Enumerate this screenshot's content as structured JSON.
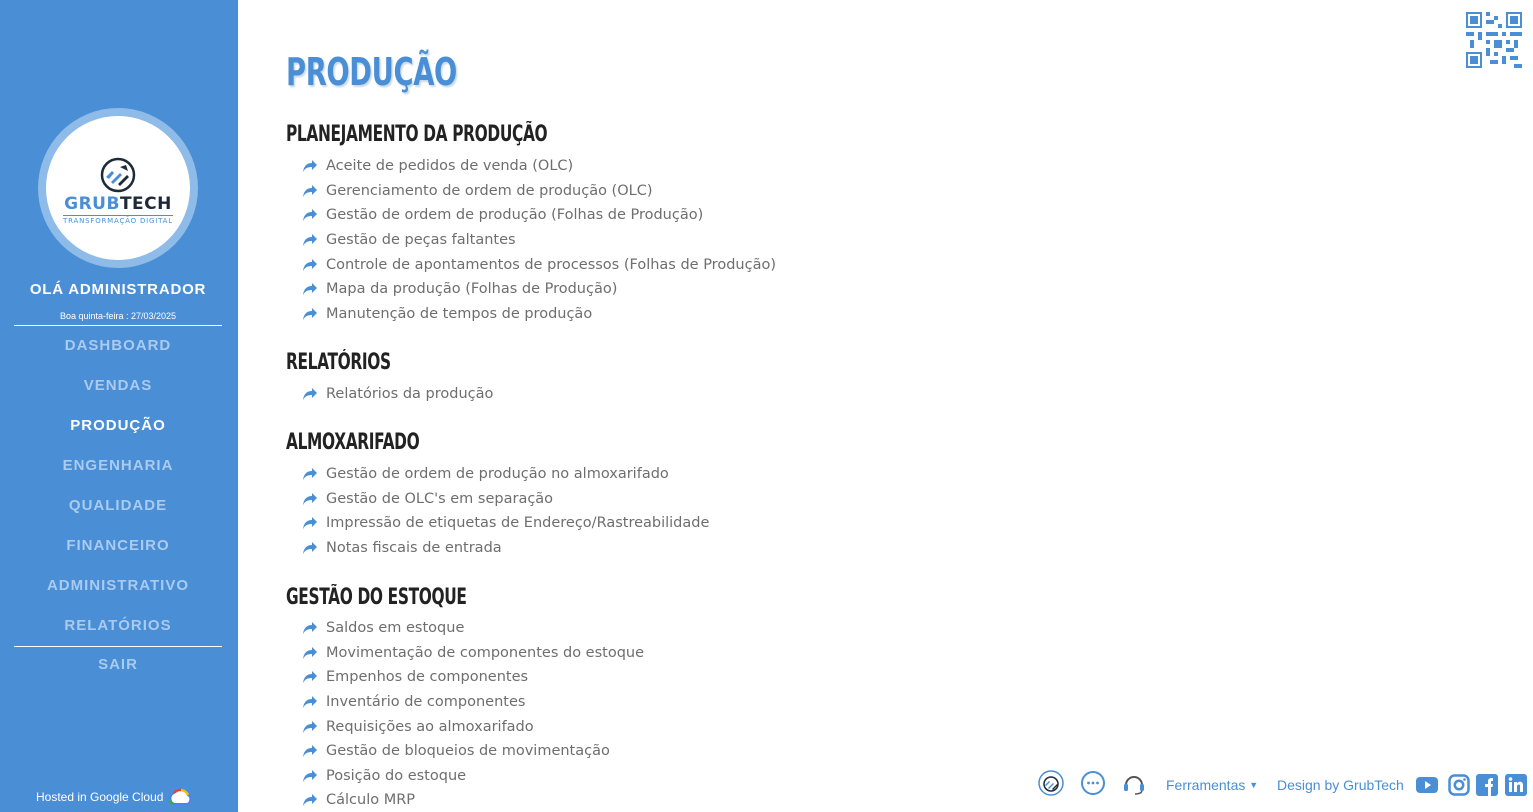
{
  "sidebar": {
    "logo": {
      "grub": "GRUB",
      "tech": "TECH",
      "tagline": "TRANSFORMAÇÃO DIGITAL"
    },
    "greeting": "OLÁ ADMINISTRADOR",
    "date": "Boa quinta-feira : 27/03/2025",
    "nav": [
      "DASHBOARD",
      "VENDAS",
      "PRODUÇÃO",
      "ENGENHARIA",
      "QUALIDADE",
      "FINANCEIRO",
      "ADMINISTRATIVO",
      "RELATÓRIOS"
    ],
    "active": "PRODUÇÃO",
    "logout": "SAIR",
    "hosted": "Hosted in Google Cloud"
  },
  "main": {
    "title": "PRODUÇÃO",
    "sections": [
      {
        "title": "PLANEJAMENTO DA PRODUÇÃO",
        "links": [
          "Aceite de pedidos de venda (OLC)",
          "Gerenciamento de ordem de produção (OLC)",
          "Gestão de ordem de produção (Folhas de Produção)",
          "Gestão de peças faltantes",
          "Controle de apontamentos de processos (Folhas de Produção)",
          "Mapa da produção (Folhas de Produção)",
          "Manutenção de tempos de produção"
        ]
      },
      {
        "title": "RELATÓRIOS",
        "links": [
          "Relatórios da produção"
        ]
      },
      {
        "title": "ALMOXARIFADO",
        "links": [
          "Gestão de ordem de produção no almoxarifado",
          "Gestão de OLC's em separação",
          "Impressão de etiquetas de Endereço/Rastreabilidade",
          "Notas fiscais de entrada"
        ]
      },
      {
        "title": "GESTÃO DO ESTOQUE",
        "links": [
          "Saldos em estoque",
          "Movimentação de componentes do estoque",
          "Empenhos de componentes",
          "Inventário de componentes",
          "Requisições ao almoxarifado",
          "Gestão de bloqueios de movimentação",
          "Posição do estoque",
          "Cálculo MRP"
        ]
      }
    ]
  },
  "footer": {
    "tools": "Ferramentas",
    "design": "Design by GrubTech",
    "icons": [
      "grubtech-icon",
      "chat-icon",
      "support-headset-icon"
    ],
    "social": [
      "youtube-icon",
      "instagram-icon",
      "facebook-icon",
      "linkedin-icon"
    ]
  },
  "colors": {
    "accent": "#4a8ed6",
    "sidebar_muted": "#a9cbef",
    "link_text": "#6e6e6e",
    "heading": "#222222"
  }
}
